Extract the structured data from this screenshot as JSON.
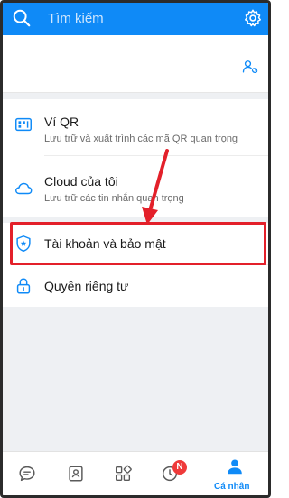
{
  "search": {
    "placeholder": "Tìm kiếm"
  },
  "menu": {
    "qr": {
      "title": "Ví QR",
      "subtitle": "Lưu trữ và xuất trình các mã QR quan trọng"
    },
    "cloud": {
      "title": "Cloud của tôi",
      "subtitle": "Lưu trữ các tin nhắn quan trọng"
    },
    "security": {
      "title": "Tài khoản và bảo mật"
    },
    "privacy": {
      "title": "Quyền riêng tư"
    }
  },
  "tabbar": {
    "badge": "N",
    "active_label": "Cá nhân"
  },
  "colors": {
    "accent": "#0f8af7",
    "highlight": "#e3202a",
    "badge": "#ef3a3a"
  }
}
